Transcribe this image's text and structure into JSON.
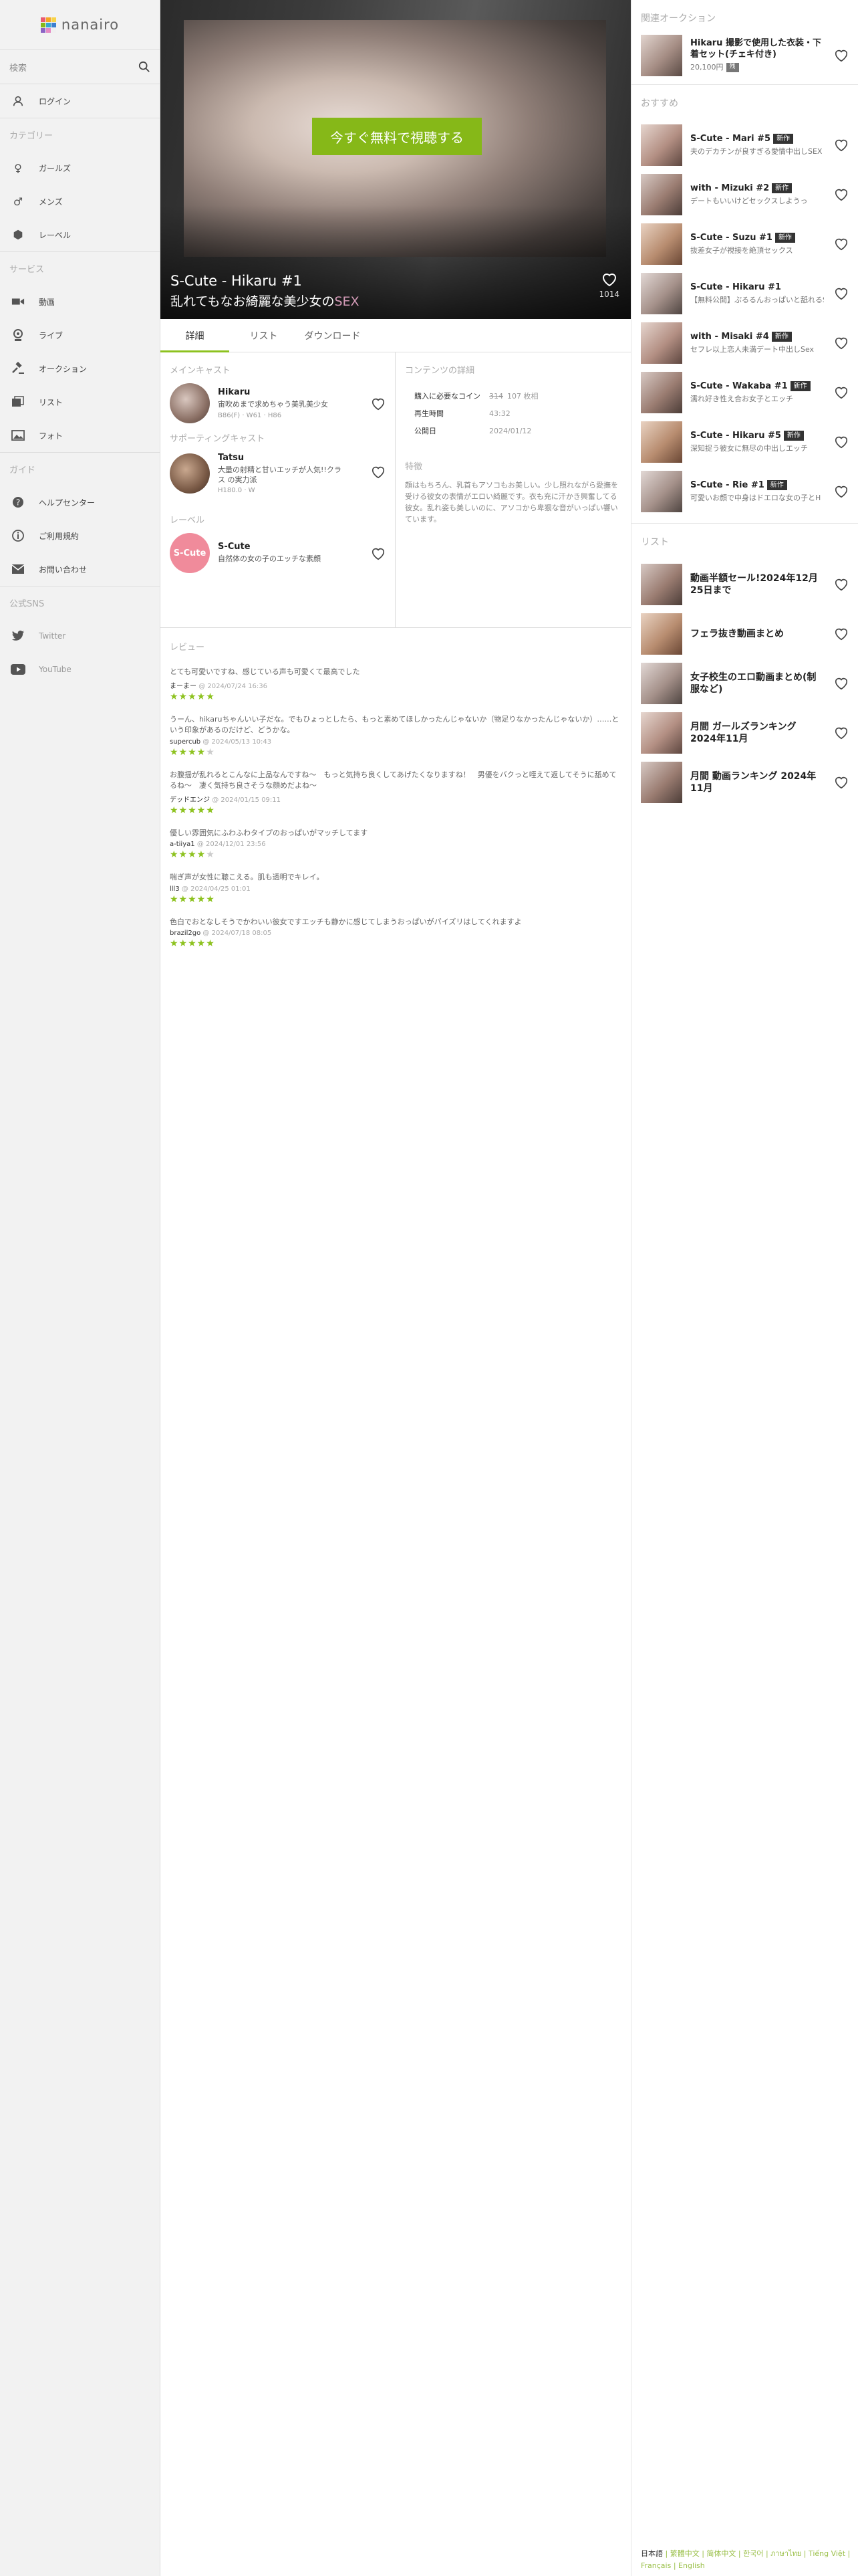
{
  "app": {
    "brand": "nanairo",
    "logo_colors": [
      "#ea5a6f",
      "#f5a623",
      "#f8d347",
      "#86b818",
      "#37a6cf",
      "#3d7fcf",
      "#8c63c5",
      "#e58ac4",
      "#ccc"
    ]
  },
  "search": {
    "placeholder": "検索"
  },
  "sidebar": {
    "login": "ログイン",
    "category_header": "カテゴリー",
    "categories": [
      "ガールズ",
      "メンズ",
      "レーベル"
    ],
    "service_header": "サービス",
    "services": [
      "動画",
      "ライブ",
      "オークション",
      "リスト",
      "フォト"
    ],
    "guide_header": "ガイド",
    "guides": [
      "ヘルプセンター",
      "ご利用規約",
      "お問い合わせ"
    ],
    "official_header": "公式SNS",
    "sns": [
      "Twitter",
      "YouTube"
    ]
  },
  "hero": {
    "cta": "今すぐ無料で視聴する",
    "title": "S-Cute - Hikaru #1",
    "subtitle_main": "乱れてもなお綺麗な美少女の",
    "subtitle_hl": "SEX",
    "likes": "1014"
  },
  "tabs": [
    "詳細",
    "リスト",
    "ダウンロード"
  ],
  "cast": {
    "main_header": "メインキャスト",
    "main": {
      "name": "Hikaru",
      "desc": "宙吹めまで求めちゃう美乳美少女",
      "meta": "B86(F) · W61 · H86"
    },
    "supporting_header": "サポーティングキャスト",
    "supporting": {
      "name": "Tatsu",
      "desc": "大量の射精と甘いエッチが人気!!クラス の実力派",
      "meta": "H180.0 · W"
    },
    "label_header": "レーベル",
    "label": {
      "name": "S-Cute",
      "desc": "自然体の女の子のエッチな素顔",
      "logo": "S-Cute"
    }
  },
  "details": {
    "header": "コンテンツの詳細",
    "rows": [
      {
        "k": "購入に必要なコイン",
        "old": "314",
        "v": "107 枚相"
      },
      {
        "k": "再生時間",
        "v": "43:32"
      },
      {
        "k": "公開日",
        "v": "2024/01/12"
      }
    ],
    "feature_header": "特徴",
    "feature": "顔はもちろん、乳首もアソコもお美しい。少し照れながら愛撫を受ける彼女の表情がエロい綺麗です。衣も充に汗かき興奮してる彼女。乱れ姿も美しいのに、アソコから卑猥な音がいっぱい響いています。"
  },
  "reviews": {
    "header": "レビュー",
    "items": [
      {
        "text": "とても可愛いですね、感じている声も可愛くて最高でした",
        "user": "まーまー",
        "date": "2024/07/24 16:36",
        "stars": 5
      },
      {
        "text": "うーん、hikaruちゃんいい子だな。でもひょっとしたら、もっと素めてほしかったんじゃないか（物足りなかったんじゃないか）……という印象があるのだけど、どうかな。",
        "user": "supercub",
        "date": "2024/05/13 10:43",
        "stars": 4
      },
      {
        "text": "お腹揺が乱れるとこんなに上品なんですね〜　もっと気持ち良くしてあげたくなりますね！　男優をバクっと咥えて返してそうに舐めてるね〜　凄く気持ち良さそうな顔めだよね〜",
        "user": "デッドエンジ",
        "date": "2024/01/15 09:11",
        "stars": 5
      },
      {
        "text": "優しい雰囲気にふわふわタイプのおっぱいがマッチしてます",
        "user": "a-tiiya1",
        "date": "2024/12/01 23:56",
        "stars": 4
      },
      {
        "text": "喘ぎ声が女性に聴こえる。肌も透明でキレイ。",
        "user": "lll3",
        "date": "2024/04/25 01:01",
        "stars": 5
      },
      {
        "text": "色白でおとなしそうでかわいい彼女ですエッチも静かに感じてしまうおっぱいがパイズリはしてくれますよ",
        "user": "brazil2go",
        "date": "2024/07/18 08:05",
        "stars": 5
      }
    ]
  },
  "right": {
    "auction_header": "関連オークション",
    "auction": {
      "title": "Hikaru 撮影で使用した衣装・下着セット(チェキ付き)",
      "price": "20,100円",
      "tag": "残"
    },
    "rec_header": "おすすめ",
    "recs": [
      {
        "title": "S-Cute - Mari #5",
        "badge": "新作",
        "sub": "夫のデカチンが良すぎる愛情中出しSEX"
      },
      {
        "title": "with - Mizuki #2",
        "badge": "新作",
        "sub": "デートもいいけどセックスしようっ"
      },
      {
        "title": "S-Cute - Suzu #1",
        "badge": "新作",
        "sub": "抜差女子が視接を絶頂セックス"
      },
      {
        "title": "S-Cute - Hikaru #1",
        "badge": "",
        "sub": "【無料公開】ぷるるんおっぱいと舐れるSEX"
      },
      {
        "title": "with - Misaki #4",
        "badge": "新作",
        "sub": "セフレ以上恋人未満デート中出しSex"
      },
      {
        "title": "S-Cute - Wakaba #1",
        "badge": "新作",
        "sub": "濡れ好き性え合お女子とエッチ"
      },
      {
        "title": "S-Cute - Hikaru #5",
        "badge": "新作",
        "sub": "深知捉う彼女に無尽の中出しエッチ"
      },
      {
        "title": "S-Cute - Rie #1",
        "badge": "新作",
        "sub": "可愛いお顔で中身はドエロな女の子とH"
      }
    ],
    "list_header": "リスト",
    "lists": [
      {
        "title": "動画半額セール!2024年12月25日まで"
      },
      {
        "title": "フェラ抜き動画まとめ"
      },
      {
        "title": "女子校生のエロ動画まとめ(制服など)"
      },
      {
        "title": "月間 ガールズランキング 2024年11月"
      },
      {
        "title": "月間 動画ランキング 2024年11月"
      }
    ],
    "footer_lang_active": "日本語",
    "footer_langs": "| 繁體中文 | 简体中文 | 한국어 | ภาษาไทย | Tiếng Việt | Français | English"
  }
}
